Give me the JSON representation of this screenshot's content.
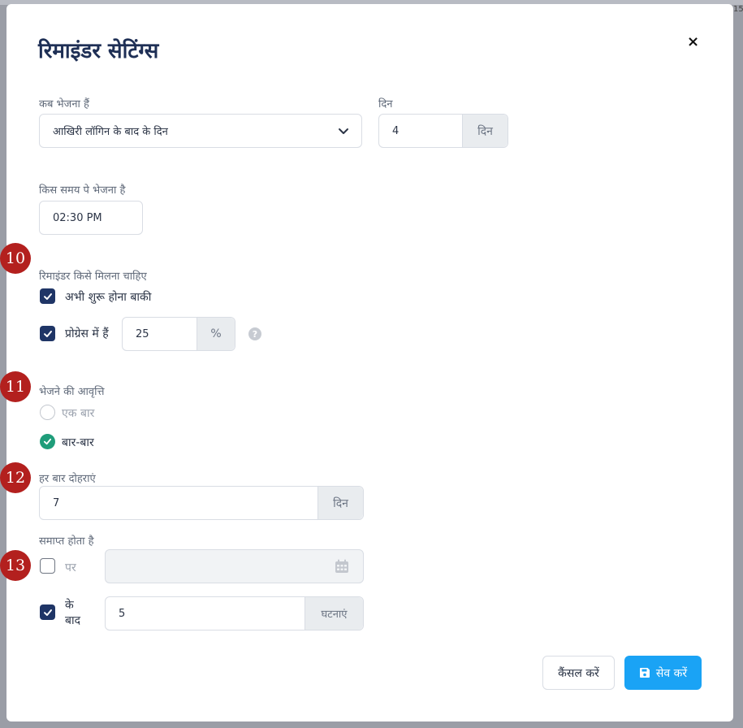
{
  "background": {
    "partial_number": "15"
  },
  "modal": {
    "title": "रिमाइंडर सेटिंग्स",
    "close_symbol": "×"
  },
  "when_to_send": {
    "label": "कब भेजना हैं",
    "selected": "आखिरी लॉगिन के बाद के दिन"
  },
  "days": {
    "label": "दिन",
    "value": "4",
    "unit": "दिन"
  },
  "send_time": {
    "label": "किस समय पे भेजना है",
    "value": "02:30 PM"
  },
  "recipients": {
    "label": "रिमाइंडर किसे मिलना चाहिए",
    "not_started": {
      "label": "अभी शुरू होना बाकी",
      "checked": true
    },
    "in_progress": {
      "label": "प्रोग्रेस में हैं",
      "checked": true,
      "value": "25",
      "unit": "%"
    }
  },
  "frequency": {
    "label": "भेजने की आवृत्ति",
    "options": [
      {
        "label": "एक बार",
        "selected": false
      },
      {
        "label": "बार-बार",
        "selected": true
      }
    ]
  },
  "repeat_every": {
    "label": "हर बार दोहराएं",
    "value": "7",
    "unit": "दिन"
  },
  "ends": {
    "label": "समाप्त होता है",
    "on": {
      "label": "पर",
      "checked": false,
      "value": ""
    },
    "after": {
      "label_line1": "के",
      "label_line2": "बाद",
      "checked": true,
      "value": "5",
      "unit": "घटनाएं"
    }
  },
  "footer": {
    "cancel_label": "कैंसल करें",
    "save_label": "सेव करें"
  },
  "annotations": [
    "10",
    "11",
    "12",
    "13"
  ],
  "colors": {
    "primary_dark": "#1f3566",
    "save_button": "#1aa3f5",
    "radio_selected": "#1f9d7a",
    "annotation_badge": "#b3201e"
  }
}
